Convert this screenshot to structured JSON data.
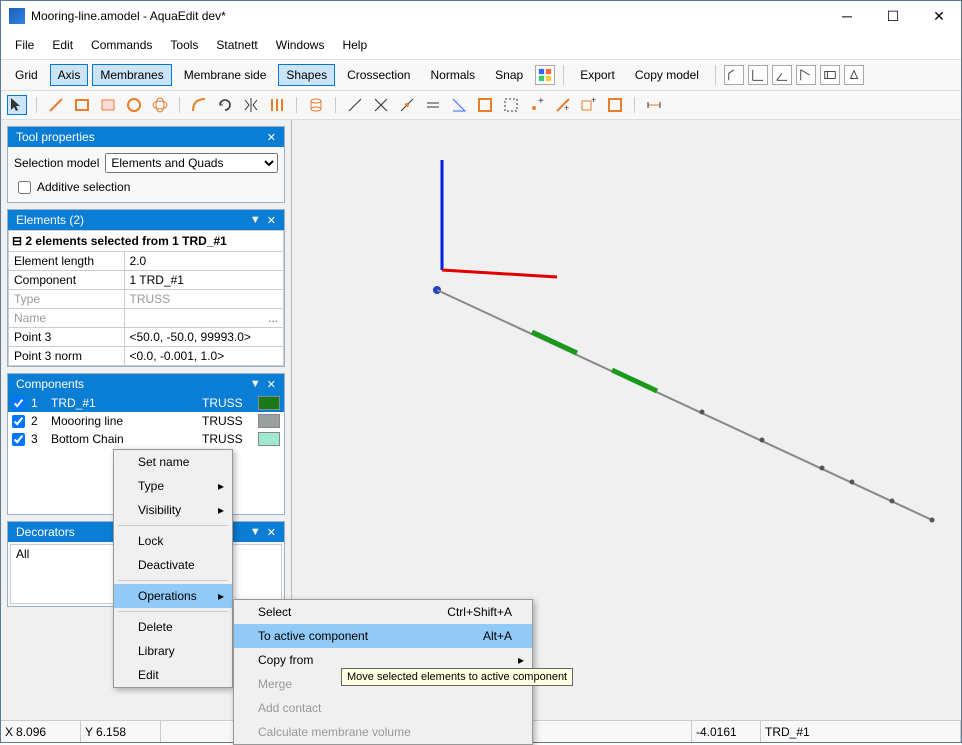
{
  "window": {
    "title": "Mooring-line.amodel - AquaEdit dev*"
  },
  "menus": {
    "file": "File",
    "edit": "Edit",
    "commands": "Commands",
    "tools": "Tools",
    "statnett": "Statnett",
    "windows": "Windows",
    "help": "Help"
  },
  "toolbar1": {
    "grid": "Grid",
    "axis": "Axis",
    "membranes": "Membranes",
    "membrane_side": "Membrane side",
    "shapes": "Shapes",
    "crossection": "Crossection",
    "normals": "Normals",
    "snap": "Snap",
    "export": "Export",
    "copy_model": "Copy model"
  },
  "panels": {
    "tool_props": {
      "title": "Tool properties",
      "selection_model_label": "Selection model",
      "selection_model_value": "Elements and Quads",
      "additive_selection": "Additive selection"
    },
    "elements": {
      "title": "Elements (2)",
      "tree_title": "2 elements selected from 1 TRD_#1",
      "rows": [
        {
          "label": "Element length",
          "value": "2.0"
        },
        {
          "label": "Component",
          "value": "1 TRD_#1"
        },
        {
          "label": "Type",
          "value": "TRUSS",
          "disabled": true
        },
        {
          "label": "Name",
          "value": "",
          "disabled": true,
          "ellipsis": true
        },
        {
          "label": "Point 3",
          "value": "<50.0, -50.0, 99993.0>"
        },
        {
          "label": "Point 3 norm",
          "value": "<0.0, -0.001, 1.0>"
        }
      ]
    },
    "components": {
      "title": "Components",
      "items": [
        {
          "n": "1",
          "name": "TRD_#1",
          "type": "TRUSS",
          "color": "#1a7a1a",
          "selected": true
        },
        {
          "n": "2",
          "name": "Moooring line",
          "type": "TRUSS",
          "color": "#9aa0a0",
          "selected": false
        },
        {
          "n": "3",
          "name": "Bottom Chain",
          "type": "TRUSS",
          "color": "#9fe8d2",
          "selected": false
        }
      ]
    },
    "decorators": {
      "title": "Decorators",
      "all": "All"
    }
  },
  "context_menu_1": {
    "set_name": "Set name",
    "type": "Type",
    "visibility": "Visibility",
    "lock": "Lock",
    "deactivate": "Deactivate",
    "operations": "Operations",
    "delete": "Delete",
    "library": "Library",
    "edit": "Edit"
  },
  "context_menu_2": {
    "select": {
      "label": "Select",
      "shortcut": "Ctrl+Shift+A"
    },
    "to_active": {
      "label": "To active component",
      "shortcut": "Alt+A"
    },
    "copy_from": "Copy from",
    "merge": "Merge",
    "add_contact": "Add contact",
    "calc_membrane": "Calculate membrane volume"
  },
  "tooltip": "Move selected elements to active component",
  "statusbar": {
    "x_label": "X",
    "x": "8.096",
    "y_label": "Y",
    "y": "6.158",
    "val1": "-4.0161",
    "val2": "TRD_#1"
  }
}
